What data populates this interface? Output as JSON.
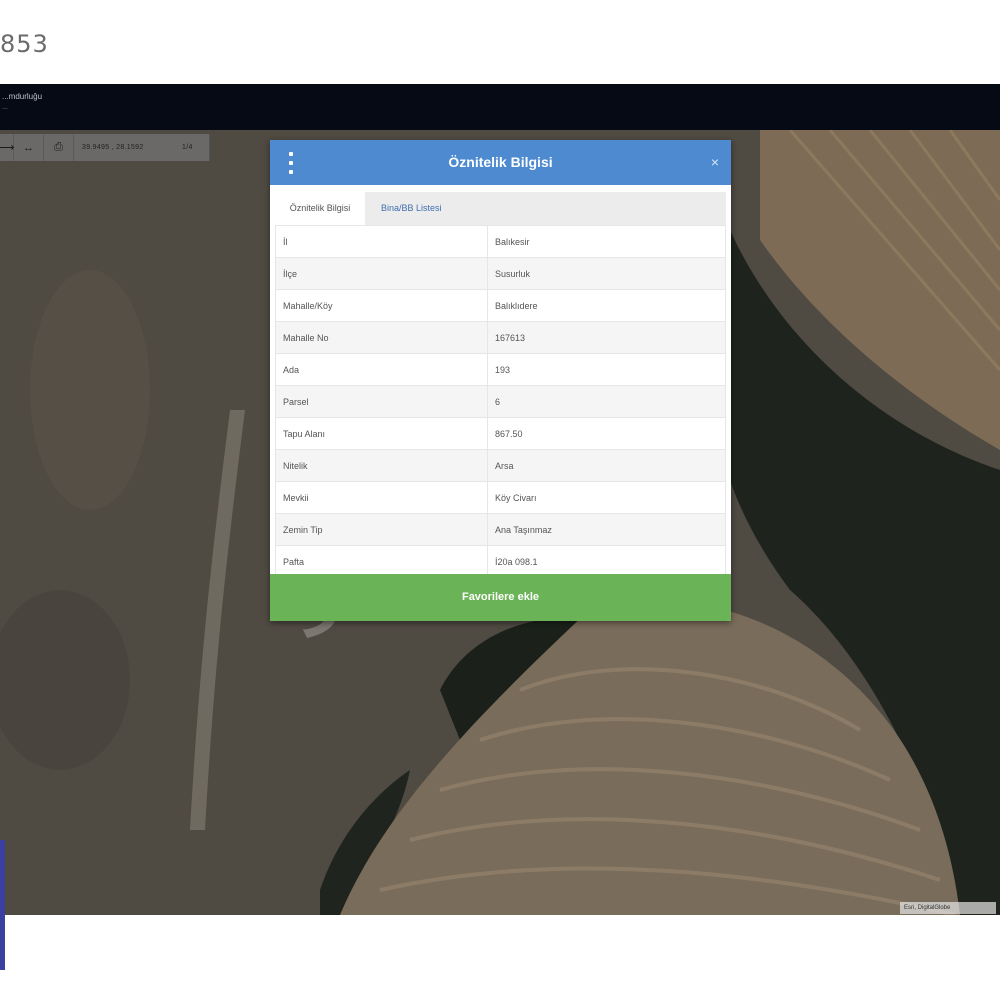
{
  "listing": {
    "number": "853"
  },
  "topbar": {
    "title": "...mdurluğu",
    "subtitle": "..."
  },
  "toolbar": {
    "buttons": [
      {
        "icon": "arrow-icon",
        "glyph": "⟶"
      },
      {
        "icon": "measure-icon",
        "glyph": "↔"
      },
      {
        "icon": "print-icon",
        "glyph": "⎙"
      }
    ],
    "coordinates": "39.9495 , 28.1592",
    "scale_label": "1/4"
  },
  "dialog": {
    "title": "Öznitelik Bilgisi",
    "close_glyph": "×",
    "tabs": [
      {
        "label": "Öznitelik Bilgisi",
        "active": true
      },
      {
        "label": "Bina/BB Listesi",
        "active": false
      }
    ],
    "rows": [
      {
        "key": "İl",
        "value": "Balıkesir"
      },
      {
        "key": "İlçe",
        "value": "Susurluk"
      },
      {
        "key": "Mahalle/Köy",
        "value": "Balıklıdere"
      },
      {
        "key": "Mahalle No",
        "value": "167613"
      },
      {
        "key": "Ada",
        "value": "193"
      },
      {
        "key": "Parsel",
        "value": "6"
      },
      {
        "key": "Tapu Alanı",
        "value": "867.50"
      },
      {
        "key": "Nitelik",
        "value": "Arsa"
      },
      {
        "key": "Mevkii",
        "value": "Köy Civarı"
      },
      {
        "key": "Zemin Tip",
        "value": "Ana Taşınmaz"
      },
      {
        "key": "Pafta",
        "value": "İ20a 098.1"
      }
    ],
    "footer_button": "Favorilere ekle"
  },
  "watermark": "sahibi",
  "attribution": "Esri, DigitalGlobe"
}
